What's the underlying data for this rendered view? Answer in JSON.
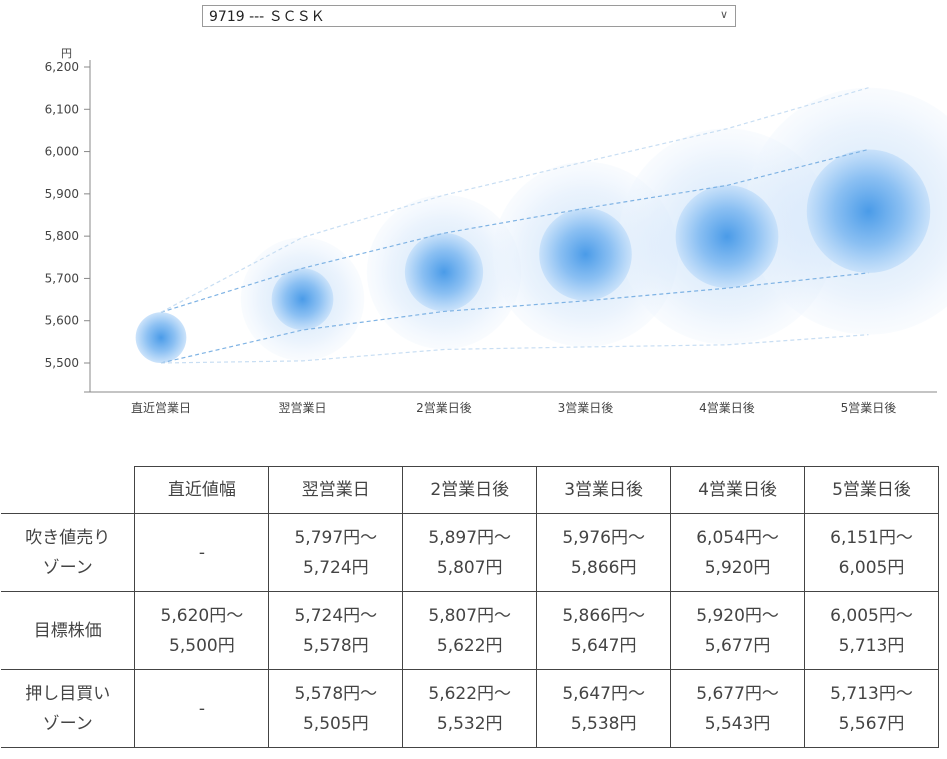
{
  "selector": {
    "value": "9719 --- ＳＣＳＫ"
  },
  "chart_data": {
    "type": "scatter",
    "y_unit": "円",
    "ylim": [
      5480,
      6200
    ],
    "yticks": [
      5500,
      5600,
      5700,
      5800,
      5900,
      6000,
      6100,
      6200
    ],
    "ytick_labels": [
      "5,500",
      "5,600",
      "5,700",
      "5,800",
      "5,900",
      "6,000",
      "6,100",
      "6,200"
    ],
    "categories": [
      "直近営業日",
      "翌営業日",
      "2営業日後",
      "3営業日後",
      "4営業日後",
      "5営業日後"
    ],
    "center": [
      5560,
      5651,
      5715,
      5757,
      5799,
      5859
    ],
    "target_high": [
      5620,
      5724,
      5807,
      5866,
      5920,
      6005
    ],
    "target_low": [
      5500,
      5578,
      5622,
      5647,
      5677,
      5713
    ],
    "outer_high": [
      5620,
      5797,
      5897,
      5976,
      6054,
      6151
    ],
    "outer_low": [
      5500,
      5505,
      5532,
      5538,
      5543,
      5567
    ],
    "grid": false,
    "colors": {
      "bubble_core": "#4a9be8",
      "bubble_edge": "#cfe6fb",
      "dash": "#9ec6ea"
    }
  },
  "table": {
    "headers": [
      "",
      "直近値幅",
      "翌営業日",
      "2営業日後",
      "3営業日後",
      "4営業日後",
      "5営業日後"
    ],
    "rows": [
      {
        "label": [
          "吹き値売り",
          "ゾーン"
        ],
        "cells": [
          [
            "-"
          ],
          [
            "5,797円～",
            "5,724円"
          ],
          [
            "5,897円～",
            "5,807円"
          ],
          [
            "5,976円～",
            "5,866円"
          ],
          [
            "6,054円～",
            "5,920円"
          ],
          [
            "6,151円～",
            "6,005円"
          ]
        ]
      },
      {
        "label": [
          "目標株価"
        ],
        "cells": [
          [
            "5,620円～",
            "5,500円"
          ],
          [
            "5,724円～",
            "5,578円"
          ],
          [
            "5,807円～",
            "5,622円"
          ],
          [
            "5,866円～",
            "5,647円"
          ],
          [
            "5,920円～",
            "5,677円"
          ],
          [
            "6,005円～",
            "5,713円"
          ]
        ]
      },
      {
        "label": [
          "押し目買い",
          "ゾーン"
        ],
        "cells": [
          [
            "-"
          ],
          [
            "5,578円～",
            "5,505円"
          ],
          [
            "5,622円～",
            "5,532円"
          ],
          [
            "5,647円～",
            "5,538円"
          ],
          [
            "5,677円～",
            "5,543円"
          ],
          [
            "5,713円～",
            "5,567円"
          ]
        ]
      }
    ]
  }
}
